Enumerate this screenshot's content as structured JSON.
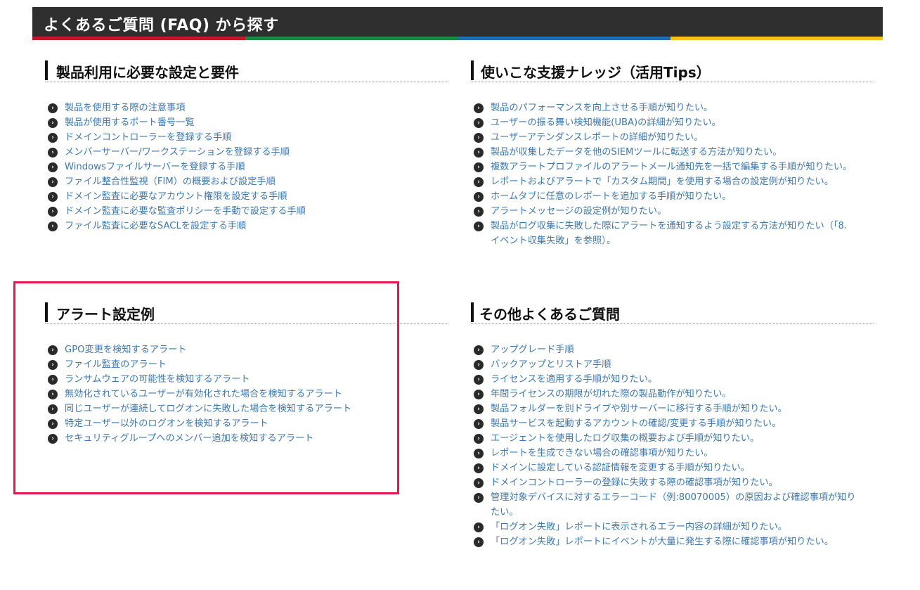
{
  "header": {
    "title": "よくあるご質問 (FAQ) から探す"
  },
  "colors": {
    "bar": [
      "#c4172c",
      "#1a8a42",
      "#1f6fb0",
      "#f5c21b"
    ],
    "link": "#3c78b4",
    "highlight": "#e8174f"
  },
  "sections": [
    {
      "title": "製品利用に必要な設定と要件",
      "items": [
        "製品を使用する際の注意事項",
        "製品が使用するポート番号一覧",
        "ドメインコントローラーを登録する手順",
        "メンバーサーバー/ワークステーションを登録する手順",
        "Windowsファイルサーバーを登録する手順",
        "ファイル整合性監視（FIM）の概要および設定手順",
        "ドメイン監査に必要なアカウント権限を設定する手順",
        "ドメイン監査に必要な監査ポリシーを手動で設定する手順",
        "ファイル監査に必要なSACLを設定する手順"
      ]
    },
    {
      "title": "使いこな支援ナレッジ（活用Tips）",
      "items": [
        "製品のパフォーマンスを向上させる手順が知りたい。",
        "ユーザーの振る舞い検知機能(UBA)の詳細が知りたい。",
        "ユーザーアテンダンスレポートの詳細が知りたい。",
        "製品が収集したデータを他のSIEMツールに転送する方法が知りたい。",
        "複数アラートプロファイルのアラートメール通知先を一括で編集する手順が知りたい。",
        "レポートおよびアラートで「カスタム期間」を使用する場合の設定例が知りたい。",
        "ホームタブに任意のレポートを追加する手順が知りたい。",
        "アラートメッセージの設定例が知りたい。",
        "製品がログ収集に失敗した際にアラートを通知するよう設定する方法が知りたい（「8. イベント収集失敗」を参照）。"
      ]
    },
    {
      "title": "アラート設定例",
      "items": [
        "GPO変更を検知するアラート",
        "ファイル監査のアラート",
        "ランサムウェアの可能性を検知するアラート",
        "無効化されているユーザーが有効化された場合を検知するアラート",
        "同じユーザーが連続してログオンに失敗した場合を検知するアラート",
        "特定ユーザー以外のログオンを検知するアラート",
        "セキュリティグループへのメンバー追加を検知するアラート"
      ]
    },
    {
      "title": "その他よくあるご質問",
      "items": [
        "アップグレード手順",
        "バックアップとリストア手順",
        "ライセンスを適用する手順が知りたい。",
        "年間ライセンスの期限が切れた際の製品動作が知りたい。",
        "製品フォルダーを別ドライブや別サーバーに移行する手順が知りたい。",
        "製品サービスを起動するアカウントの確認/変更する手順が知りたい。",
        "エージェントを使用したログ収集の概要および手順が知りたい。",
        "レポートを生成できない場合の確認事項が知りたい。",
        "ドメインに設定している認証情報を変更する手順が知りたい。",
        "ドメインコントローラーの登録に失敗する際の確認事項が知りたい。",
        "管理対象デバイスに対するエラーコード（例:80070005）の原因および確認事項が知りたい。",
        "「ログオン失敗」レポートに表示されるエラー内容の詳細が知りたい。",
        "「ログオン失敗」レポートにイベントが大量に発生する際に確認事項が知りたい。"
      ]
    }
  ]
}
